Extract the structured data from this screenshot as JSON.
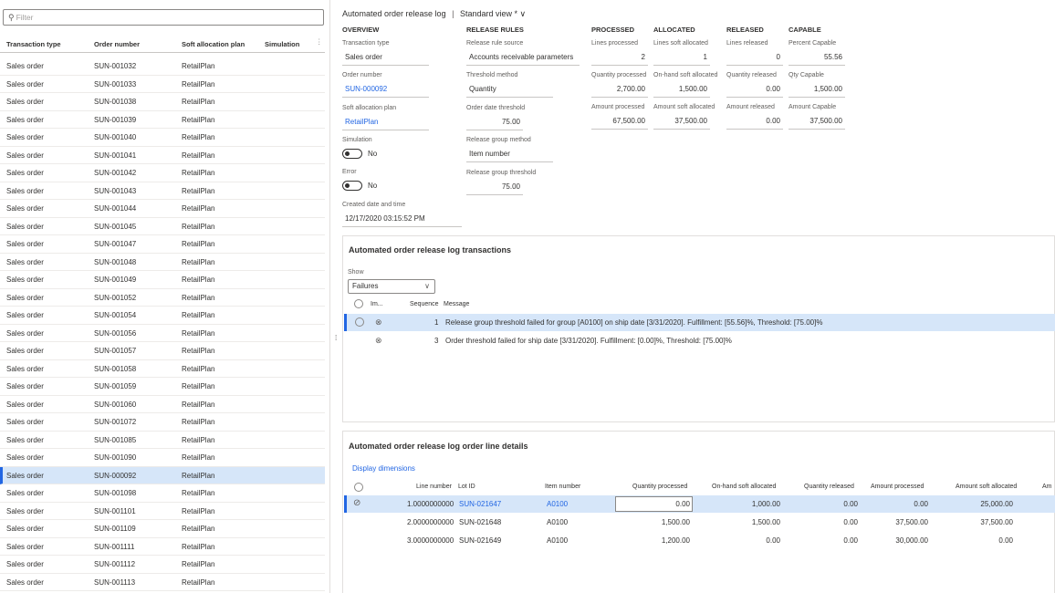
{
  "left": {
    "filter_placeholder": "Filter",
    "columns": [
      "Transaction type",
      "Order number",
      "Soft allocation plan",
      "Simulation"
    ],
    "rows": [
      [
        "Sales order",
        "SUN-001032",
        "RetailPlan"
      ],
      [
        "Sales order",
        "SUN-001033",
        "RetailPlan"
      ],
      [
        "Sales order",
        "SUN-001038",
        "RetailPlan"
      ],
      [
        "Sales order",
        "SUN-001039",
        "RetailPlan"
      ],
      [
        "Sales order",
        "SUN-001040",
        "RetailPlan"
      ],
      [
        "Sales order",
        "SUN-001041",
        "RetailPlan"
      ],
      [
        "Sales order",
        "SUN-001042",
        "RetailPlan"
      ],
      [
        "Sales order",
        "SUN-001043",
        "RetailPlan"
      ],
      [
        "Sales order",
        "SUN-001044",
        "RetailPlan"
      ],
      [
        "Sales order",
        "SUN-001045",
        "RetailPlan"
      ],
      [
        "Sales order",
        "SUN-001047",
        "RetailPlan"
      ],
      [
        "Sales order",
        "SUN-001048",
        "RetailPlan"
      ],
      [
        "Sales order",
        "SUN-001049",
        "RetailPlan"
      ],
      [
        "Sales order",
        "SUN-001052",
        "RetailPlan"
      ],
      [
        "Sales order",
        "SUN-001054",
        "RetailPlan"
      ],
      [
        "Sales order",
        "SUN-001056",
        "RetailPlan"
      ],
      [
        "Sales order",
        "SUN-001057",
        "RetailPlan"
      ],
      [
        "Sales order",
        "SUN-001058",
        "RetailPlan"
      ],
      [
        "Sales order",
        "SUN-001059",
        "RetailPlan"
      ],
      [
        "Sales order",
        "SUN-001060",
        "RetailPlan"
      ],
      [
        "Sales order",
        "SUN-001072",
        "RetailPlan"
      ],
      [
        "Sales order",
        "SUN-001085",
        "RetailPlan"
      ],
      [
        "Sales order",
        "SUN-001090",
        "RetailPlan"
      ],
      [
        "Sales order",
        "SUN-000092",
        "RetailPlan"
      ],
      [
        "Sales order",
        "SUN-001098",
        "RetailPlan"
      ],
      [
        "Sales order",
        "SUN-001101",
        "RetailPlan"
      ],
      [
        "Sales order",
        "SUN-001109",
        "RetailPlan"
      ],
      [
        "Sales order",
        "SUN-001111",
        "RetailPlan"
      ],
      [
        "Sales order",
        "SUN-001112",
        "RetailPlan"
      ],
      [
        "Sales order",
        "SUN-001113",
        "RetailPlan"
      ]
    ],
    "selected_index": 23
  },
  "header": {
    "title": "Automated order release log",
    "separator": "|",
    "view": "Standard view *",
    "view_chevron": "∨"
  },
  "overview": {
    "section": "OVERVIEW",
    "transaction_type_label": "Transaction type",
    "transaction_type": "Sales order",
    "order_number_label": "Order number",
    "order_number": "SUN-000092",
    "soft_plan_label": "Soft allocation plan",
    "soft_plan": "RetailPlan",
    "simulation_label": "Simulation",
    "simulation_value": "No",
    "error_label": "Error",
    "error_value": "No",
    "created_label": "Created date and time",
    "created_value": "12/17/2020 03:15:52 PM"
  },
  "release_rules": {
    "section": "RELEASE RULES",
    "source_label": "Release rule source",
    "source": "Accounts receivable parameters",
    "threshold_method_label": "Threshold method",
    "threshold_method": "Quantity",
    "order_date_threshold_label": "Order date threshold",
    "order_date_threshold": "75.00",
    "group_method_label": "Release group method",
    "group_method": "Item number",
    "group_threshold_label": "Release group threshold",
    "group_threshold": "75.00"
  },
  "processed": {
    "section": "PROCESSED",
    "lines_label": "Lines processed",
    "lines": "2",
    "qty_label": "Quantity processed",
    "qty": "2,700.00",
    "amount_label": "Amount processed",
    "amount": "67,500.00"
  },
  "allocated": {
    "section": "ALLOCATED",
    "lines_label": "Lines soft allocated",
    "lines": "1",
    "qty_label": "On-hand soft allocated",
    "qty": "1,500.00",
    "amount_label": "Amount soft allocated",
    "amount": "37,500.00"
  },
  "released": {
    "section": "RELEASED",
    "lines_label": "Lines released",
    "lines": "0",
    "qty_label": "Quantity released",
    "qty": "0.00",
    "amount_label": "Amount released",
    "amount": "0.00"
  },
  "capable": {
    "section": "CAPABLE",
    "pct_label": "Percent Capable",
    "pct": "55.56",
    "qty_label": "Qty Capable",
    "qty": "1,500.00",
    "amount_label": "Amount Capable",
    "amount": "37,500.00"
  },
  "transactions": {
    "title": "Automated order release log transactions",
    "show_label": "Show",
    "show_value": "Failures",
    "col_im": "Im...",
    "col_seq": "Sequence",
    "col_msg": "Message",
    "rows": [
      {
        "seq": "1",
        "msg": "Release group threshold failed for group [A0100] on ship date [3/31/2020]. Fulfillment: [55.56]%, Threshold: [75.00]%"
      },
      {
        "seq": "3",
        "msg": "Order threshold failed for ship date [3/31/2020]. Fulfillment: [0.00]%, Threshold: [75.00]%"
      }
    ]
  },
  "lines": {
    "title": "Automated order release log order line details",
    "display_dimensions": "Display dimensions",
    "columns": [
      "Line number",
      "Lot ID",
      "Item number",
      "Quantity processed",
      "On-hand soft allocated",
      "Quantity released",
      "Amount processed",
      "Amount soft allocated",
      "Am"
    ],
    "rows": [
      [
        "1.0000000000",
        "SUN-021647",
        "A0100",
        "0.00",
        "1,000.00",
        "0.00",
        "0.00",
        "25,000.00"
      ],
      [
        "2.0000000000",
        "SUN-021648",
        "A0100",
        "1,500.00",
        "1,500.00",
        "0.00",
        "37,500.00",
        "37,500.00"
      ],
      [
        "3.0000000000",
        "SUN-021649",
        "A0100",
        "1,200.00",
        "0.00",
        "0.00",
        "30,000.00",
        "0.00"
      ]
    ]
  }
}
